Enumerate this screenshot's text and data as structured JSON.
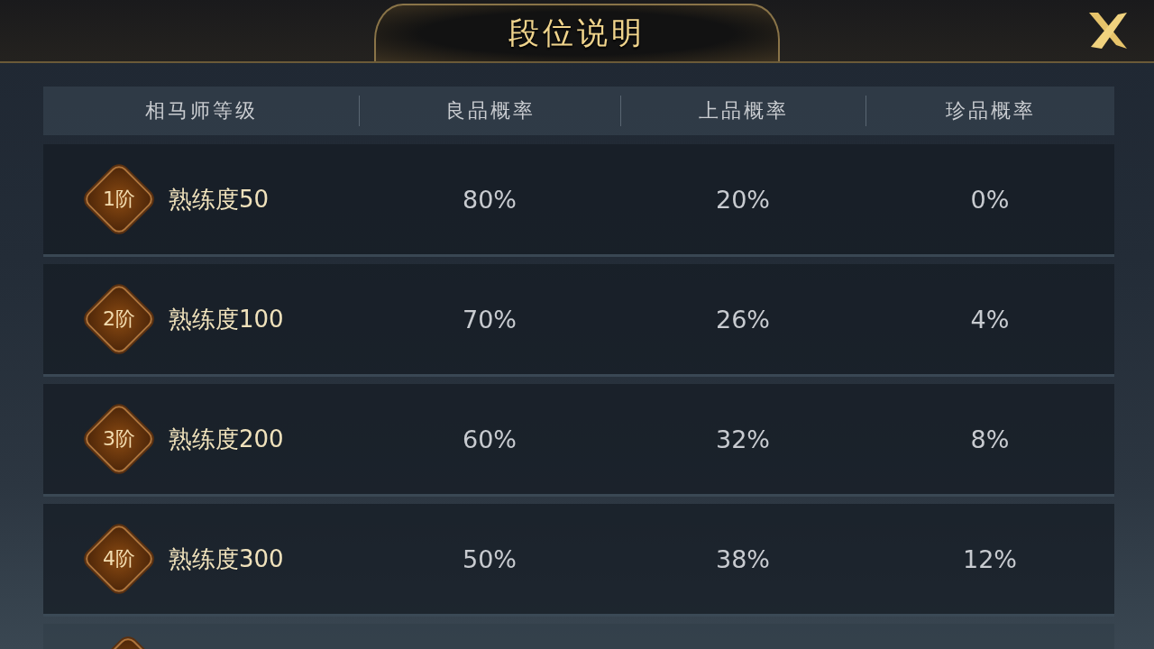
{
  "title": "段位说明",
  "columns": [
    "相马师等级",
    "良品概率",
    "上品概率",
    "珍品概率"
  ],
  "rows": [
    {
      "tier": "1阶",
      "proficiency": "熟练度50",
      "values": [
        "80%",
        "20%",
        "0%"
      ]
    },
    {
      "tier": "2阶",
      "proficiency": "熟练度100",
      "values": [
        "70%",
        "26%",
        "4%"
      ]
    },
    {
      "tier": "3阶",
      "proficiency": "熟练度200",
      "values": [
        "60%",
        "32%",
        "8%"
      ]
    },
    {
      "tier": "4阶",
      "proficiency": "熟练度300",
      "values": [
        "50%",
        "38%",
        "12%"
      ]
    }
  ],
  "more_rows_below": true
}
